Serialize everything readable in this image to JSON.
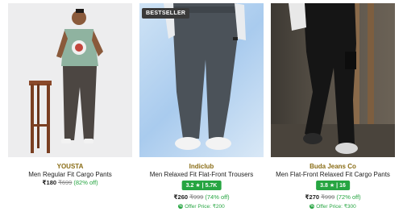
{
  "colors": {
    "brand_text": "#8a6d16",
    "rating_bg": "#26a541",
    "discount": "#26a541",
    "mrp": "#878787",
    "badge_bg": "#3a3a3a"
  },
  "products": [
    {
      "brand": "YOUSTA",
      "title": "Men Regular Fit Cargo Pants",
      "price": "₹180",
      "mrp": "₹699",
      "discount": "(82% off)"
    },
    {
      "badge": "BESTSELLER",
      "brand": "Indiclub",
      "title": "Men Relaxed Fit Flat-Front Trousers",
      "rating": "3.2 ★",
      "rating_count": "5.7K",
      "price": "₹260",
      "mrp": "₹999",
      "discount": "(74% off)",
      "offer_icon": "offer-tag-icon",
      "offer": "Offer Price: ₹200"
    },
    {
      "brand": "Buda Jeans Co",
      "title": "Men Flat-Front Relaxed Fit Cargo Pants",
      "rating": "3.8 ★",
      "rating_count": "16",
      "price": "₹270",
      "mrp": "₹999",
      "discount": "(72% off)",
      "offer_icon": "offer-tag-icon",
      "offer": "Offer Price: ₹300"
    }
  ]
}
